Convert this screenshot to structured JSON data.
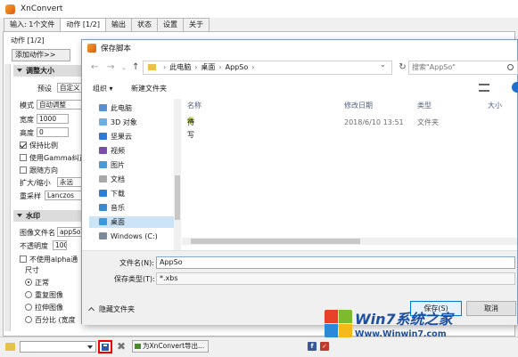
{
  "app": {
    "title": "XnConvert"
  },
  "tabs": [
    "输入: 1个文件",
    "动作 [1/2]",
    "输出",
    "状态",
    "设置",
    "关于"
  ],
  "actions": {
    "section_label": "动作 [1/2]",
    "add_action": "添加动作>>",
    "resize": {
      "header": "调整大小",
      "preset_label": "预设",
      "preset_value": "自定义",
      "mode_label": "模式",
      "mode_value": "自动调整",
      "width_label": "宽度",
      "width_value": "1000",
      "height_label": "高度",
      "height_value": "0",
      "keep_ratio": "保持比例",
      "use_gamma": "使用Gamma纠正",
      "follow_direction": "跟随方向",
      "enlarge_label": "扩大/缩小",
      "enlarge_value": "永远",
      "resample_label": "重采样",
      "resample_value": "Lanczos"
    },
    "watermark": {
      "header": "水印",
      "image_file_label": "图像文件名",
      "image_file_value": "appSoV",
      "opacity_label": "不透明度",
      "opacity_value": "100",
      "no_alpha": "不使用alpha通",
      "size_label": "尺寸",
      "size_normal": "正常",
      "size_repeat": "重复图像",
      "size_stretch": "拉伸图像",
      "size_percent": "百分比 (宽度"
    }
  },
  "bottom": {
    "export_button": "为XnConvert导出..."
  },
  "dialog": {
    "title": "保存脚本",
    "breadcrumb": [
      "此电脑",
      "桌面",
      "AppSo"
    ],
    "search_placeholder": "搜索\"AppSo\"",
    "organize": "组织 ▾",
    "new_folder": "新建文件夹",
    "nav": [
      "此电脑",
      "3D 对象",
      "坚果云",
      "视频",
      "图片",
      "文档",
      "下载",
      "音乐",
      "桌面",
      "Windows (C:)"
    ],
    "columns": [
      "名称",
      "修改日期",
      "类型",
      "大小"
    ],
    "files": [
      {
        "name": "待写",
        "date": "2018/6/10 13:51",
        "type": "文件夹"
      }
    ],
    "filename_label": "文件名(N):",
    "filename_value": "AppSo",
    "filetype_label": "保存类型(T):",
    "filetype_value": "*.xbs",
    "hide_folders": "隐藏文件夹",
    "save_button": "保存(S)",
    "cancel_button": "取消"
  },
  "watermark_site": {
    "line1": "Win7系统之家",
    "line2": "Www.Winwin7.com"
  }
}
